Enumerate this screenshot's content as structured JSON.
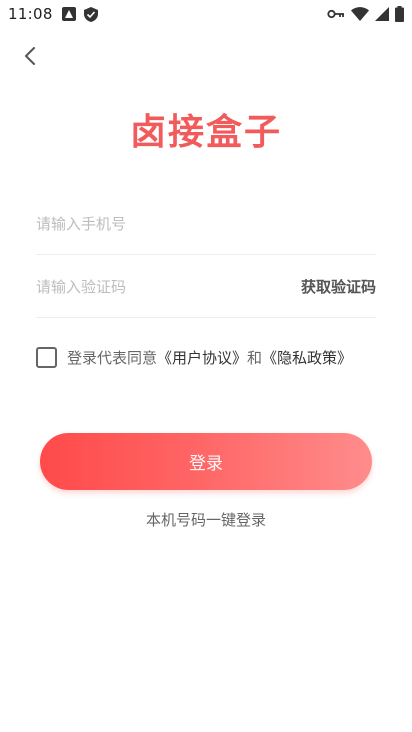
{
  "status_bar": {
    "time": "11:08",
    "left_icons": [
      "a-icon",
      "shield-icon"
    ],
    "right_icons": [
      "key-icon",
      "wifi-icon",
      "signal-icon",
      "battery-icon"
    ]
  },
  "nav": {
    "back_icon": "chevron-left-icon"
  },
  "logo": {
    "text": "卤接盒子",
    "color": "#f25b5b"
  },
  "form": {
    "phone_placeholder": "请输入手机号",
    "phone_value": "",
    "code_placeholder": "请输入验证码",
    "code_value": "",
    "get_code_label": "获取验证码"
  },
  "agreement": {
    "checked": false,
    "prefix": "登录代表同意",
    "user_agreement": "《用户协议》",
    "conjunction": "和",
    "privacy_policy": "《隐私政策》"
  },
  "login_button": {
    "label": "登录",
    "gradient_start": "#ff4a4a",
    "gradient_end": "#ff8c8c"
  },
  "one_key_login": {
    "label": "本机号码一键登录"
  }
}
